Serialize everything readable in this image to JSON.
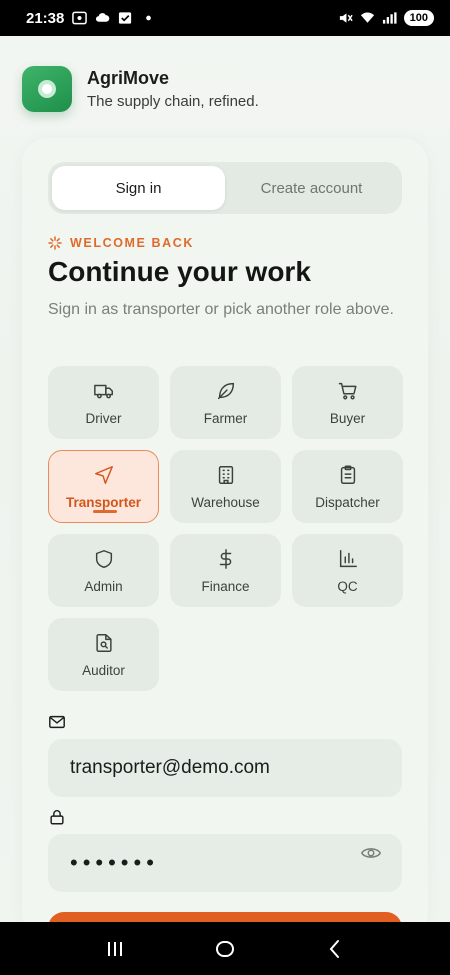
{
  "status_bar": {
    "time": "21:38",
    "battery": "100"
  },
  "app": {
    "name": "AgriMove",
    "tagline": "The supply chain, refined."
  },
  "tabs": [
    {
      "label": "Sign in",
      "active": true
    },
    {
      "label": "Create account",
      "active": false
    }
  ],
  "eyebrow": "WELCOME BACK",
  "title": "Continue your work",
  "subtitle": "Sign in as transporter or pick another role above.",
  "roles": [
    {
      "label": "Driver",
      "icon": "truck-icon"
    },
    {
      "label": "Farmer",
      "icon": "leaf-icon"
    },
    {
      "label": "Buyer",
      "icon": "cart-icon"
    },
    {
      "label": "Transporter",
      "icon": "navigation-icon",
      "selected": true
    },
    {
      "label": "Warehouse",
      "icon": "building-icon"
    },
    {
      "label": "Dispatcher",
      "icon": "clipboard-icon"
    },
    {
      "label": "Admin",
      "icon": "shield-icon"
    },
    {
      "label": "Finance",
      "icon": "dollar-icon"
    },
    {
      "label": "QC",
      "icon": "bar-chart-icon"
    },
    {
      "label": "Auditor",
      "icon": "file-search-icon"
    }
  ],
  "email": {
    "value": "transporter@demo.com",
    "icon": "mail-icon"
  },
  "password": {
    "masked_value": "•••••••",
    "icon": "lock-icon",
    "toggle_icon": "eye-icon"
  },
  "colors": {
    "accent": "#e06a2c",
    "brand": "#2a9d55",
    "cta": "#e25f22"
  }
}
